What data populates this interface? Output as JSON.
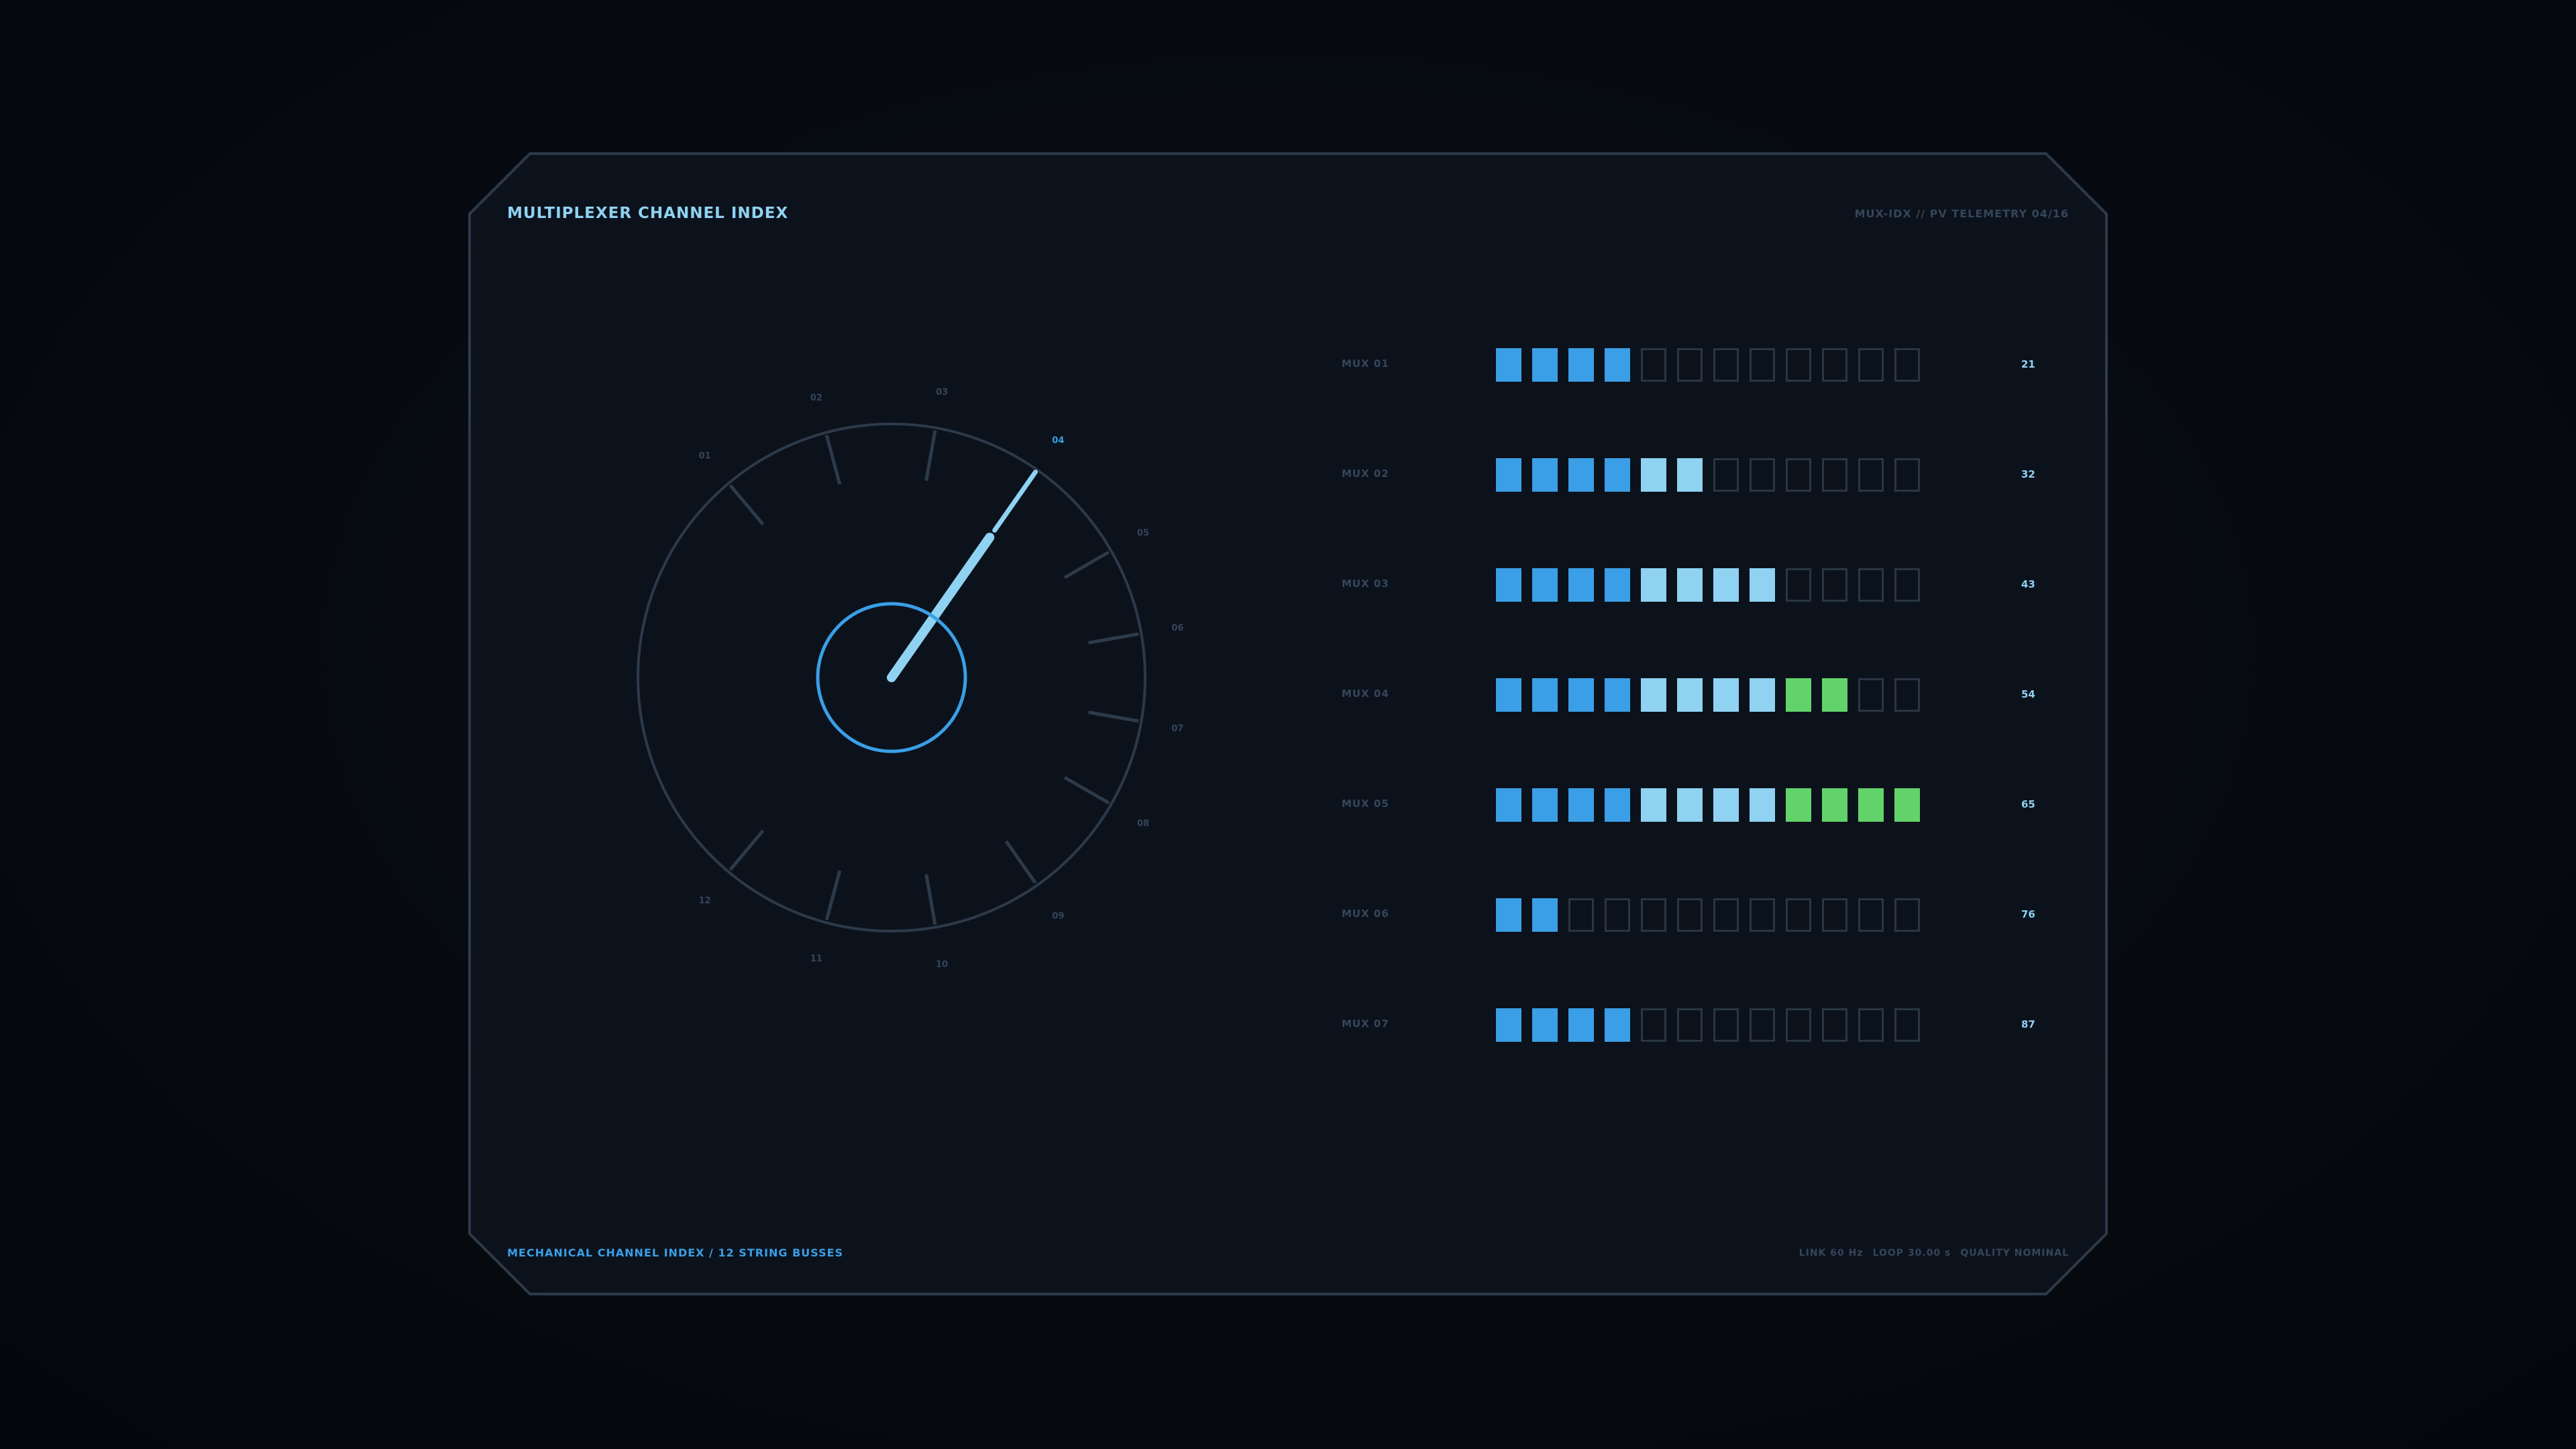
{
  "panel": {
    "title": "MULTIPLEXER CHANNEL INDEX",
    "header_right": "MUX-IDX  //  PV TELEMETRY  04/16",
    "footer_left": "MECHANICAL CHANNEL INDEX / 12 STRING BUSSES",
    "footer_right": [
      "LINK 60 Hz",
      "LOOP 30.00 s",
      "QUALITY NOMINAL"
    ]
  },
  "dial": {
    "channels": [
      "01",
      "02",
      "03",
      "04",
      "05",
      "06",
      "07",
      "08",
      "09",
      "10",
      "11",
      "12"
    ],
    "active_channel": "04"
  },
  "mux": {
    "rows": [
      {
        "label": "MUX 01",
        "value": "21",
        "lit": 4
      },
      {
        "label": "MUX 02",
        "value": "32",
        "lit": 6
      },
      {
        "label": "MUX 03",
        "value": "43",
        "lit": 8
      },
      {
        "label": "MUX 04",
        "value": "54",
        "lit": 10
      },
      {
        "label": "MUX 05",
        "value": "65",
        "lit": 12
      },
      {
        "label": "MUX 06",
        "value": "76",
        "lit": 2
      },
      {
        "label": "MUX 07",
        "value": "87",
        "lit": 4
      }
    ],
    "cells_per_row": 12
  },
  "colors": {
    "panel_bg": "#0c121c",
    "frame": "#2c3a4a",
    "accent": "#3a9fe6",
    "accent_light": "#8fd2f2",
    "green": "#62d36a",
    "dim": "#34465a"
  }
}
